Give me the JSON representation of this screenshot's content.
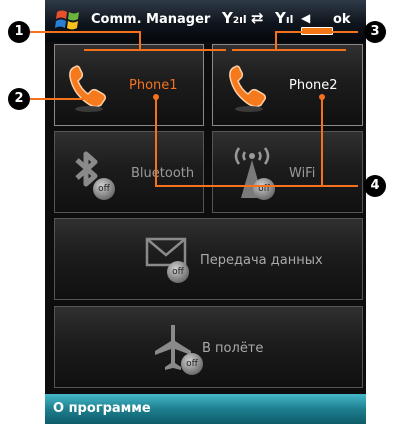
{
  "status_bar": {
    "app_title": "Comm. Manager",
    "ok_label": "ok",
    "signal1": "Y",
    "signal1_sub": "2",
    "sync_glyph": "⇄",
    "signal2": "Y",
    "volume_glyph": "◀"
  },
  "tiles": {
    "phone1": {
      "label": "Phone1",
      "state": "on",
      "icon": "phone-icon"
    },
    "phone2": {
      "label": "Phone2",
      "state": "on",
      "icon": "phone-icon"
    },
    "bluetooth": {
      "label": "Bluetooth",
      "state": "off",
      "badge": "off",
      "icon": "bluetooth-icon"
    },
    "wifi": {
      "label": "WiFi",
      "state": "off",
      "badge": "off",
      "icon": "wifi-icon"
    },
    "data": {
      "label": "Передача данных",
      "state": "off",
      "badge": "off",
      "icon": "mail-icon"
    },
    "flight": {
      "label": "В полёте",
      "state": "off",
      "badge": "off",
      "icon": "airplane-icon"
    }
  },
  "bottom_bar": {
    "about_label": "О программе"
  },
  "callouts": [
    "1",
    "2",
    "3",
    "4"
  ],
  "colors": {
    "accent_orange": "#f5721d",
    "bottom_teal": "#1e7f8f",
    "callout": "#000000"
  }
}
